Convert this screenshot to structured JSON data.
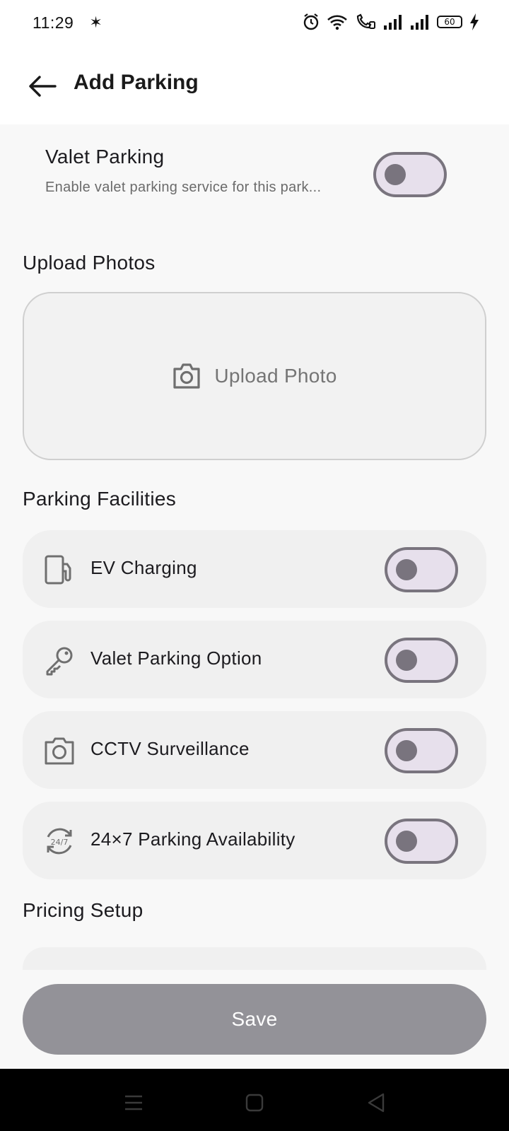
{
  "status_bar": {
    "time": "11:29",
    "battery": "60",
    "icons": [
      "pinwheel-icon",
      "alarm-icon",
      "wifi-icon",
      "wifi-call-icon",
      "signal-icon",
      "signal-icon",
      "battery-icon",
      "charging-icon"
    ]
  },
  "header": {
    "title": "Add Parking",
    "back_icon": "arrow-left-icon"
  },
  "valet": {
    "title": "Valet Parking",
    "subtitle": "Enable valet parking service for this park...",
    "enabled": false
  },
  "upload": {
    "section_title": "Upload Photos",
    "button_label": "Upload Photo",
    "icon": "camera-icon"
  },
  "facilities": {
    "section_title": "Parking Facilities",
    "items": [
      {
        "label": "EV Charging",
        "icon": "ev-charger-icon",
        "enabled": false
      },
      {
        "label": "Valet Parking Option",
        "icon": "key-icon",
        "enabled": false
      },
      {
        "label": "CCTV Surveillance",
        "icon": "cctv-camera-icon",
        "enabled": false
      },
      {
        "label": "24×7 Parking Availability",
        "icon": "clock-24-7-icon",
        "enabled": false
      }
    ]
  },
  "pricing": {
    "section_title": "Pricing Setup"
  },
  "footer": {
    "save_label": "Save"
  },
  "nav_bar": {
    "icons": [
      "menu-icon",
      "home-square-icon",
      "back-triangle-icon"
    ]
  },
  "colors": {
    "toggle_track": "#e7e0ec",
    "toggle_outline": "#79747e",
    "save_button": "#939298",
    "card_background": "#f0f0f0"
  }
}
